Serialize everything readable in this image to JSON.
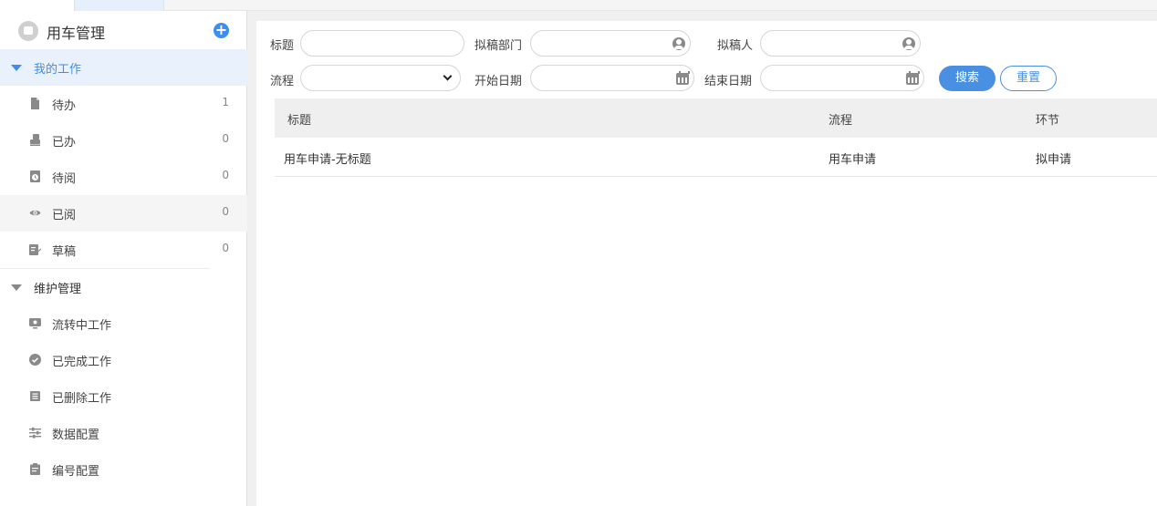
{
  "sidebar": {
    "app_title": "用车管理",
    "add_label": "+",
    "groups": [
      {
        "label": "我的工作",
        "items": [
          {
            "label": "待办",
            "count": "1",
            "icon": "file-icon"
          },
          {
            "label": "已办",
            "count": "0",
            "icon": "stamp-icon"
          },
          {
            "label": "待阅",
            "count": "0",
            "icon": "clock-icon"
          },
          {
            "label": "已阅",
            "count": "0",
            "icon": "eye-icon"
          },
          {
            "label": "草稿",
            "count": "0",
            "icon": "edit-icon"
          }
        ]
      },
      {
        "label": "维护管理",
        "items": [
          {
            "label": "流转中工作",
            "icon": "monitor-icon"
          },
          {
            "label": "已完成工作",
            "icon": "check-circle-icon"
          },
          {
            "label": "已删除工作",
            "icon": "trash-icon"
          },
          {
            "label": "数据配置",
            "icon": "sliders-icon"
          },
          {
            "label": "编号配置",
            "icon": "clipboard-icon"
          }
        ]
      }
    ]
  },
  "filters": {
    "title_label": "标题",
    "title_value": "",
    "dept_label": "拟稿部门",
    "dept_value": "",
    "drafter_label": "拟稿人",
    "drafter_value": "",
    "flow_label": "流程",
    "flow_value": "",
    "start_label": "开始日期",
    "start_value": "",
    "end_label": "结束日期",
    "end_value": "",
    "search_label": "搜索",
    "reset_label": "重置"
  },
  "table": {
    "columns": [
      "标题",
      "流程",
      "环节"
    ],
    "rows": [
      [
        "用车申请-无标题",
        "用车申请",
        "拟申请"
      ]
    ]
  },
  "colors": {
    "accent": "#4a90e2",
    "active_bg": "#e8f1fc"
  }
}
